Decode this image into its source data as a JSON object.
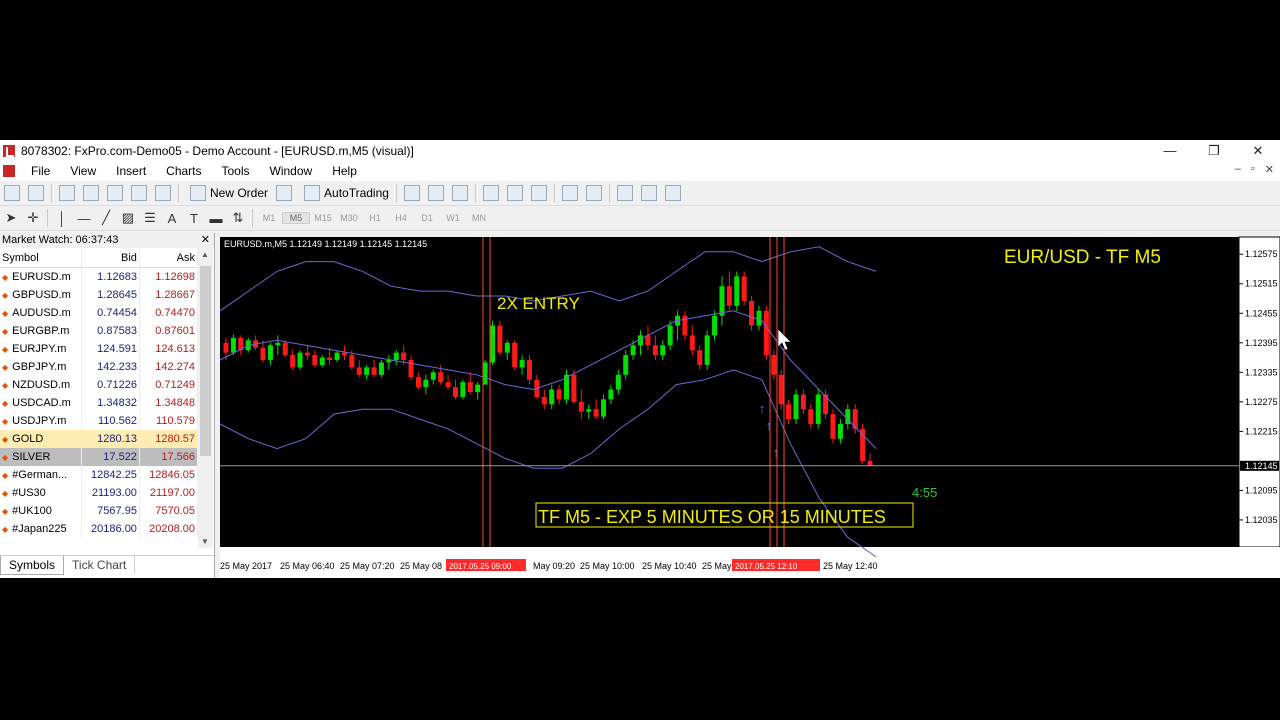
{
  "window": {
    "title": "8078302: FxPro.com-Demo05 - Demo Account - [EURUSD.m,M5 (visual)]",
    "controls": [
      "—",
      "❐",
      "✕"
    ]
  },
  "menu": [
    "File",
    "View",
    "Insert",
    "Charts",
    "Tools",
    "Window",
    "Help"
  ],
  "toolbar": {
    "new_order": "New Order",
    "autotrading": "AutoTrading",
    "timeframes": [
      "M1",
      "M5",
      "M15",
      "M30",
      "H1",
      "H4",
      "D1",
      "W1",
      "MN"
    ],
    "active_timeframe": "M5"
  },
  "market_watch": {
    "title": "Market Watch: 06:37:43",
    "columns": [
      "Symbol",
      "Bid",
      "Ask"
    ],
    "rows": [
      {
        "symbol": "EURUSD.m",
        "bid": "1.12683",
        "ask": "1.12698"
      },
      {
        "symbol": "GBPUSD.m",
        "bid": "1.28645",
        "ask": "1.28667"
      },
      {
        "symbol": "AUDUSD.m",
        "bid": "0.74454",
        "ask": "0.74470"
      },
      {
        "symbol": "EURGBP.m",
        "bid": "0.87583",
        "ask": "0.87601"
      },
      {
        "symbol": "EURJPY.m",
        "bid": "124.591",
        "ask": "124.613"
      },
      {
        "symbol": "GBPJPY.m",
        "bid": "142.233",
        "ask": "142.274"
      },
      {
        "symbol": "NZDUSD.m",
        "bid": "0.71226",
        "ask": "0.71249"
      },
      {
        "symbol": "USDCAD.m",
        "bid": "1.34832",
        "ask": "1.34848"
      },
      {
        "symbol": "USDJPY.m",
        "bid": "110.562",
        "ask": "110.579"
      },
      {
        "symbol": "GOLD",
        "bid": "1280.13",
        "ask": "1280.57"
      },
      {
        "symbol": "SILVER",
        "bid": "17.522",
        "ask": "17.566"
      },
      {
        "symbol": "#German...",
        "bid": "12842.25",
        "ask": "12846.05"
      },
      {
        "symbol": "#US30",
        "bid": "21193.00",
        "ask": "21197.00"
      },
      {
        "symbol": "#UK100",
        "bid": "7567.95",
        "ask": "7570.05"
      },
      {
        "symbol": "#Japan225",
        "bid": "20186.00",
        "ask": "20208.00"
      }
    ],
    "tabs": [
      "Symbols",
      "Tick Chart"
    ]
  },
  "chart": {
    "header": "EURUSD.m,M5  1.12149 1.12149 1.12145 1.12145",
    "pair_label": "EUR/USD - TF M5",
    "entry_label": "2X ENTRY",
    "timer": "4:55",
    "expiry_label": "TF M5 - EXP 5 MINUTES OR 15 MINUTES",
    "current_price": "1.12145",
    "price_ticks": [
      "1.12575",
      "1.12515",
      "1.12455",
      "1.12395",
      "1.12335",
      "1.12275",
      "1.12215",
      "1.12095",
      "1.12035"
    ],
    "time_ticks": [
      "25 May 2017",
      "25 May 06:40",
      "25 May 07:20",
      "25 May 08",
      "May 09:20",
      "25 May 10:00",
      "25 May 10:40",
      "25 May",
      "25 May 12:40"
    ],
    "time_highlights": [
      "2017.05.25 09:00",
      "2017.05.25 12:10"
    ],
    "colors": {
      "bull": "#00e000",
      "bear": "#ff1a1a",
      "bands": "#6a6ad8",
      "label": "#f2ef00",
      "marker": "#ff4a2a",
      "timer": "#2ec82e"
    }
  },
  "chart_data": {
    "type": "candlestick",
    "y_range": [
      1.1198,
      1.1261
    ],
    "candles": [
      [
        1.12395,
        1.12405,
        1.1236,
        1.12375
      ],
      [
        1.12375,
        1.12412,
        1.1237,
        1.12405
      ],
      [
        1.12405,
        1.1241,
        1.1237,
        1.1238
      ],
      [
        1.1238,
        1.12405,
        1.12375,
        1.124
      ],
      [
        1.124,
        1.1241,
        1.1238,
        1.12385
      ],
      [
        1.12385,
        1.124,
        1.12355,
        1.1236
      ],
      [
        1.1236,
        1.12395,
        1.1235,
        1.1239
      ],
      [
        1.1239,
        1.1241,
        1.1237,
        1.12395
      ],
      [
        1.12395,
        1.124,
        1.12365,
        1.1237
      ],
      [
        1.1237,
        1.1238,
        1.1234,
        1.12345
      ],
      [
        1.12345,
        1.1238,
        1.1234,
        1.12375
      ],
      [
        1.12375,
        1.1239,
        1.1236,
        1.1237
      ],
      [
        1.1237,
        1.1238,
        1.12345,
        1.1235
      ],
      [
        1.1235,
        1.1237,
        1.12345,
        1.12365
      ],
      [
        1.12365,
        1.12385,
        1.1235,
        1.1236
      ],
      [
        1.1236,
        1.1238,
        1.12355,
        1.12375
      ],
      [
        1.12375,
        1.1239,
        1.1236,
        1.1237
      ],
      [
        1.1237,
        1.1238,
        1.1234,
        1.12345
      ],
      [
        1.12345,
        1.1236,
        1.12325,
        1.1233
      ],
      [
        1.1233,
        1.1235,
        1.1232,
        1.12345
      ],
      [
        1.12345,
        1.1236,
        1.12325,
        1.1233
      ],
      [
        1.1233,
        1.1236,
        1.12325,
        1.12355
      ],
      [
        1.12355,
        1.1237,
        1.1234,
        1.1236
      ],
      [
        1.1236,
        1.1238,
        1.1235,
        1.12375
      ],
      [
        1.12375,
        1.1239,
        1.1235,
        1.1236
      ],
      [
        1.1236,
        1.1237,
        1.1232,
        1.12325
      ],
      [
        1.12325,
        1.12335,
        1.123,
        1.12305
      ],
      [
        1.12305,
        1.1233,
        1.1229,
        1.1232
      ],
      [
        1.1232,
        1.1234,
        1.1231,
        1.12335
      ],
      [
        1.12335,
        1.1235,
        1.1231,
        1.12315
      ],
      [
        1.12315,
        1.1233,
        1.123,
        1.12305
      ],
      [
        1.12305,
        1.1232,
        1.1228,
        1.12285
      ],
      [
        1.12285,
        1.1232,
        1.1228,
        1.12315
      ],
      [
        1.12315,
        1.12335,
        1.1229,
        1.12295
      ],
      [
        1.12295,
        1.12315,
        1.1228,
        1.1231
      ],
      [
        1.1231,
        1.1236,
        1.1231,
        1.12355
      ],
      [
        1.12355,
        1.1244,
        1.1235,
        1.1243
      ],
      [
        1.1243,
        1.1244,
        1.1237,
        1.12375
      ],
      [
        1.12375,
        1.124,
        1.1236,
        1.12395
      ],
      [
        1.12395,
        1.124,
        1.1234,
        1.12345
      ],
      [
        1.12345,
        1.1237,
        1.1233,
        1.1236
      ],
      [
        1.1236,
        1.1237,
        1.1231,
        1.1232
      ],
      [
        1.1232,
        1.1233,
        1.1228,
        1.12285
      ],
      [
        1.12285,
        1.123,
        1.1226,
        1.1227
      ],
      [
        1.1227,
        1.1231,
        1.1226,
        1.123
      ],
      [
        1.123,
        1.1231,
        1.1227,
        1.1228
      ],
      [
        1.1228,
        1.1234,
        1.1227,
        1.1233
      ],
      [
        1.1233,
        1.1234,
        1.1227,
        1.12275
      ],
      [
        1.12275,
        1.123,
        1.1224,
        1.12255
      ],
      [
        1.12255,
        1.1227,
        1.1224,
        1.1226
      ],
      [
        1.1226,
        1.1228,
        1.1224,
        1.12245
      ],
      [
        1.12245,
        1.1229,
        1.1224,
        1.1228
      ],
      [
        1.1228,
        1.1231,
        1.1227,
        1.123
      ],
      [
        1.123,
        1.1234,
        1.1229,
        1.1233
      ],
      [
        1.1233,
        1.1238,
        1.1232,
        1.1237
      ],
      [
        1.1237,
        1.124,
        1.1236,
        1.1239
      ],
      [
        1.1239,
        1.1242,
        1.1237,
        1.1241
      ],
      [
        1.1241,
        1.1243,
        1.1238,
        1.1239
      ],
      [
        1.1239,
        1.1241,
        1.1236,
        1.1237
      ],
      [
        1.1237,
        1.124,
        1.1236,
        1.1239
      ],
      [
        1.1239,
        1.1244,
        1.1238,
        1.1243
      ],
      [
        1.1243,
        1.1246,
        1.124,
        1.1245
      ],
      [
        1.1245,
        1.1246,
        1.124,
        1.1241
      ],
      [
        1.1241,
        1.1243,
        1.1237,
        1.1238
      ],
      [
        1.1238,
        1.1239,
        1.1234,
        1.1235
      ],
      [
        1.1235,
        1.1242,
        1.1234,
        1.1241
      ],
      [
        1.1241,
        1.1246,
        1.124,
        1.1245
      ],
      [
        1.1245,
        1.1253,
        1.1243,
        1.1251
      ],
      [
        1.1251,
        1.1254,
        1.1246,
        1.1247
      ],
      [
        1.1247,
        1.1254,
        1.1246,
        1.1253
      ],
      [
        1.1253,
        1.1254,
        1.1247,
        1.1248
      ],
      [
        1.1248,
        1.1249,
        1.1242,
        1.1243
      ],
      [
        1.1243,
        1.1247,
        1.1242,
        1.1246
      ],
      [
        1.1246,
        1.1247,
        1.1236,
        1.1237
      ],
      [
        1.1237,
        1.1238,
        1.1232,
        1.1233
      ],
      [
        1.1233,
        1.1234,
        1.1226,
        1.1227
      ],
      [
        1.1227,
        1.1228,
        1.1223,
        1.1224
      ],
      [
        1.1224,
        1.123,
        1.1223,
        1.1229
      ],
      [
        1.1229,
        1.123,
        1.1225,
        1.1226
      ],
      [
        1.1226,
        1.1227,
        1.1222,
        1.1223
      ],
      [
        1.1223,
        1.123,
        1.1222,
        1.1229
      ],
      [
        1.1229,
        1.123,
        1.1224,
        1.1225
      ],
      [
        1.1225,
        1.1226,
        1.1219,
        1.122
      ],
      [
        1.122,
        1.1224,
        1.1219,
        1.1223
      ],
      [
        1.1223,
        1.1227,
        1.1222,
        1.1226
      ],
      [
        1.1226,
        1.1227,
        1.1221,
        1.1222
      ],
      [
        1.1222,
        1.1223,
        1.1215,
        1.12155
      ],
      [
        1.12155,
        1.1217,
        1.12145,
        1.12145
      ]
    ],
    "upper_band": [
      1.1246,
      1.125,
      1.1254,
      1.1256,
      1.1256,
      1.1254,
      1.1251,
      1.125,
      1.125,
      1.1249,
      1.1249,
      1.1248,
      1.1249,
      1.125,
      1.1248,
      1.125,
      1.1254,
      1.1258,
      1.1258,
      1.1256,
      1.1258,
      1.1259,
      1.1256,
      1.1254
    ],
    "middle_band": [
      1.1236,
      1.1239,
      1.124,
      1.1239,
      1.1238,
      1.1237,
      1.1236,
      1.1235,
      1.1234,
      1.1233,
      1.1231,
      1.123,
      1.1232,
      1.1235,
      1.1238,
      1.1241,
      1.1244,
      1.1245,
      1.1246,
      1.1244,
      1.1236,
      1.123,
      1.1224,
      1.1218
    ],
    "lower_band": [
      1.1223,
      1.122,
      1.1218,
      1.122,
      1.1225,
      1.1226,
      1.1226,
      1.1224,
      1.1222,
      1.1219,
      1.1216,
      1.1214,
      1.1214,
      1.1217,
      1.1222,
      1.1226,
      1.1231,
      1.1232,
      1.1234,
      1.1232,
      1.1219,
      1.1208,
      1.12,
      1.1196
    ]
  }
}
